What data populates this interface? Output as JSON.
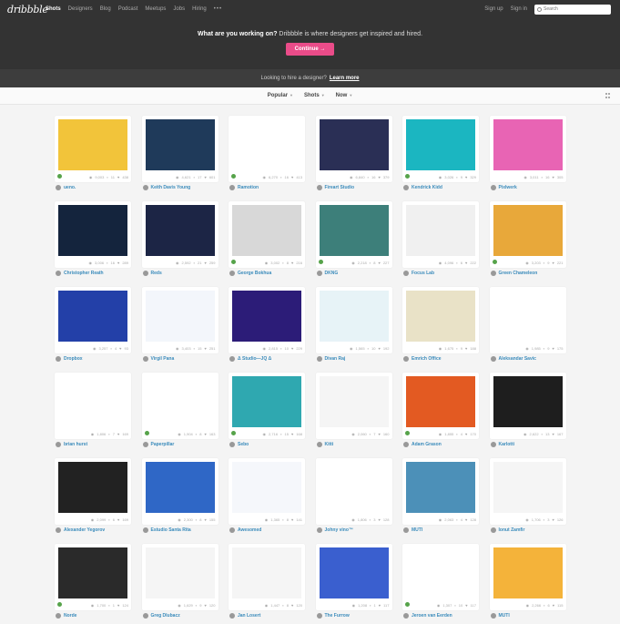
{
  "nav": {
    "logo": "dribbble",
    "links": [
      "Shots",
      "Designers",
      "Blog",
      "Podcast",
      "Meetups",
      "Jobs",
      "Hiring"
    ],
    "more": "•••",
    "signup": "Sign up",
    "signin": "Sign in",
    "search_placeholder": "Search"
  },
  "hero": {
    "strong": "What are you working on?",
    "text": " Dribbble is where designers get inspired and hired.",
    "cta": "Continue →"
  },
  "hire": {
    "text": "Looking to hire a designer?",
    "link": "Learn more"
  },
  "filters": [
    "Popular",
    "Shots",
    "Now"
  ],
  "shots": [
    {
      "author": "ueno.",
      "views": "9,003",
      "comments": "11",
      "likes": "438",
      "bg": "#f2c43a",
      "badge": "#56a34a"
    },
    {
      "author": "Keith Davis Young",
      "views": "4,621",
      "comments": "17",
      "likes": "601",
      "bg": "#1f3a5a",
      "badge": ""
    },
    {
      "author": "Ramotion",
      "views": "6,270",
      "comments": "16",
      "likes": "413",
      "bg": "#ffffff",
      "badge": "#56a34a"
    },
    {
      "author": "Fireart Studio",
      "views": "6,840",
      "comments": "16",
      "likes": "379",
      "bg": "#2a2f55",
      "badge": ""
    },
    {
      "author": "Kendrick Kidd",
      "views": "3,026",
      "comments": "9",
      "likes": "329",
      "bg": "#1bb6c1",
      "badge": "#56a34a"
    },
    {
      "author": "Pixlwerk",
      "views": "3,011",
      "comments": "16",
      "likes": "305",
      "bg": "#e864b4",
      "badge": ""
    },
    {
      "author": "Christopher Reath",
      "views": "3,006",
      "comments": "16",
      "likes": "289",
      "bg": "#14243d",
      "badge": ""
    },
    {
      "author": "Reds",
      "views": "2,592",
      "comments": "21",
      "likes": "259",
      "bg": "#1c2545",
      "badge": ""
    },
    {
      "author": "George Bokhua",
      "views": "3,002",
      "comments": "8",
      "likes": "216",
      "bg": "#d8d8d8",
      "badge": "#56a34a"
    },
    {
      "author": "DKNG",
      "views": "2,218",
      "comments": "8",
      "likes": "227",
      "bg": "#3d7f7a",
      "badge": "#56a34a"
    },
    {
      "author": "Focus Lab",
      "views": "4,096",
      "comments": "6",
      "likes": "222",
      "bg": "#f0f0f0",
      "badge": ""
    },
    {
      "author": "Green Chameleon",
      "views": "3,203",
      "comments": "9",
      "likes": "221",
      "bg": "#e8a83a",
      "badge": "#56a34a"
    },
    {
      "author": "Dropbox",
      "views": "3,257",
      "comments": "4",
      "likes": "93",
      "bg": "#2340a8",
      "badge": ""
    },
    {
      "author": "Virgil Pana",
      "views": "3,403",
      "comments": "15",
      "likes": "251",
      "bg": "#f3f6fb",
      "badge": ""
    },
    {
      "author": "Δ Studio—JQ Δ",
      "views": "2,815",
      "comments": "10",
      "likes": "229",
      "bg": "#2c1c78",
      "badge": ""
    },
    {
      "author": "Divan Raj",
      "views": "1,565",
      "comments": "10",
      "likes": "192",
      "bg": "#e7f3f7",
      "badge": ""
    },
    {
      "author": "Emrich Office",
      "views": "1,675",
      "comments": "9",
      "likes": "188",
      "bg": "#e9e2c7",
      "badge": ""
    },
    {
      "author": "Aleksandar Savic",
      "views": "1,985",
      "comments": "9",
      "likes": "175",
      "bg": "#ffffff",
      "badge": ""
    },
    {
      "author": "brian hurst",
      "views": "1,806",
      "comments": "7",
      "likes": "169",
      "bg": "#ffffff",
      "badge": ""
    },
    {
      "author": "Paperpillar",
      "views": "1,904",
      "comments": "8",
      "likes": "163",
      "bg": "#ffffff",
      "badge": "#56a34a"
    },
    {
      "author": "Sebo",
      "views": "2,716",
      "comments": "15",
      "likes": "168",
      "bg": "#2fa8b0",
      "badge": "#56a34a"
    },
    {
      "author": "Kitti",
      "views": "2,060",
      "comments": "7",
      "likes": "160",
      "bg": "#f5f5f5",
      "badge": ""
    },
    {
      "author": "Adam Grason",
      "views": "1,855",
      "comments": "4",
      "likes": "170",
      "bg": "#e35a22",
      "badge": "#56a34a"
    },
    {
      "author": "Karlotti",
      "views": "2,622",
      "comments": "13",
      "likes": "167",
      "bg": "#1e1e1e",
      "badge": ""
    },
    {
      "author": "Alexander Yegorov",
      "views": "2,099",
      "comments": "6",
      "likes": "169",
      "bg": "#222222",
      "badge": ""
    },
    {
      "author": "Estudio Santa Rita",
      "views": "2,300",
      "comments": "8",
      "likes": "155",
      "bg": "#2f67c6",
      "badge": ""
    },
    {
      "author": "Awesomed",
      "views": "1,365",
      "comments": "8",
      "likes": "141",
      "bg": "#f5f7fb",
      "badge": ""
    },
    {
      "author": "Johny vino™",
      "views": "1,806",
      "comments": "3",
      "likes": "128",
      "bg": "#ffffff",
      "badge": ""
    },
    {
      "author": "MUTI",
      "views": "2,063",
      "comments": "4",
      "likes": "128",
      "bg": "#4c90b8",
      "badge": ""
    },
    {
      "author": "Ionut Zamfir",
      "views": "1,706",
      "comments": "3",
      "likes": "126",
      "bg": "#f5f5f5",
      "badge": ""
    },
    {
      "author": "Norde",
      "views": "1,700",
      "comments": "1",
      "likes": "124",
      "bg": "#2a2a2a",
      "badge": "#56a34a"
    },
    {
      "author": "Greg Dlubacz",
      "views": "1,629",
      "comments": "9",
      "likes": "120",
      "bg": "#f5f5f5",
      "badge": ""
    },
    {
      "author": "Jan Losert",
      "views": "1,447",
      "comments": "8",
      "likes": "120",
      "bg": "#f5f5f5",
      "badge": ""
    },
    {
      "author": "The Furrow",
      "views": "1,208",
      "comments": "1",
      "likes": "117",
      "bg": "#3a5fcf",
      "badge": ""
    },
    {
      "author": "Jeroen van Eerden",
      "views": "1,307",
      "comments": "10",
      "likes": "117",
      "bg": "#ffffff",
      "badge": "#56a34a"
    },
    {
      "author": "MUTI",
      "views": "2,266",
      "comments": "6",
      "likes": "115",
      "bg": "#f4b33a",
      "badge": ""
    }
  ]
}
